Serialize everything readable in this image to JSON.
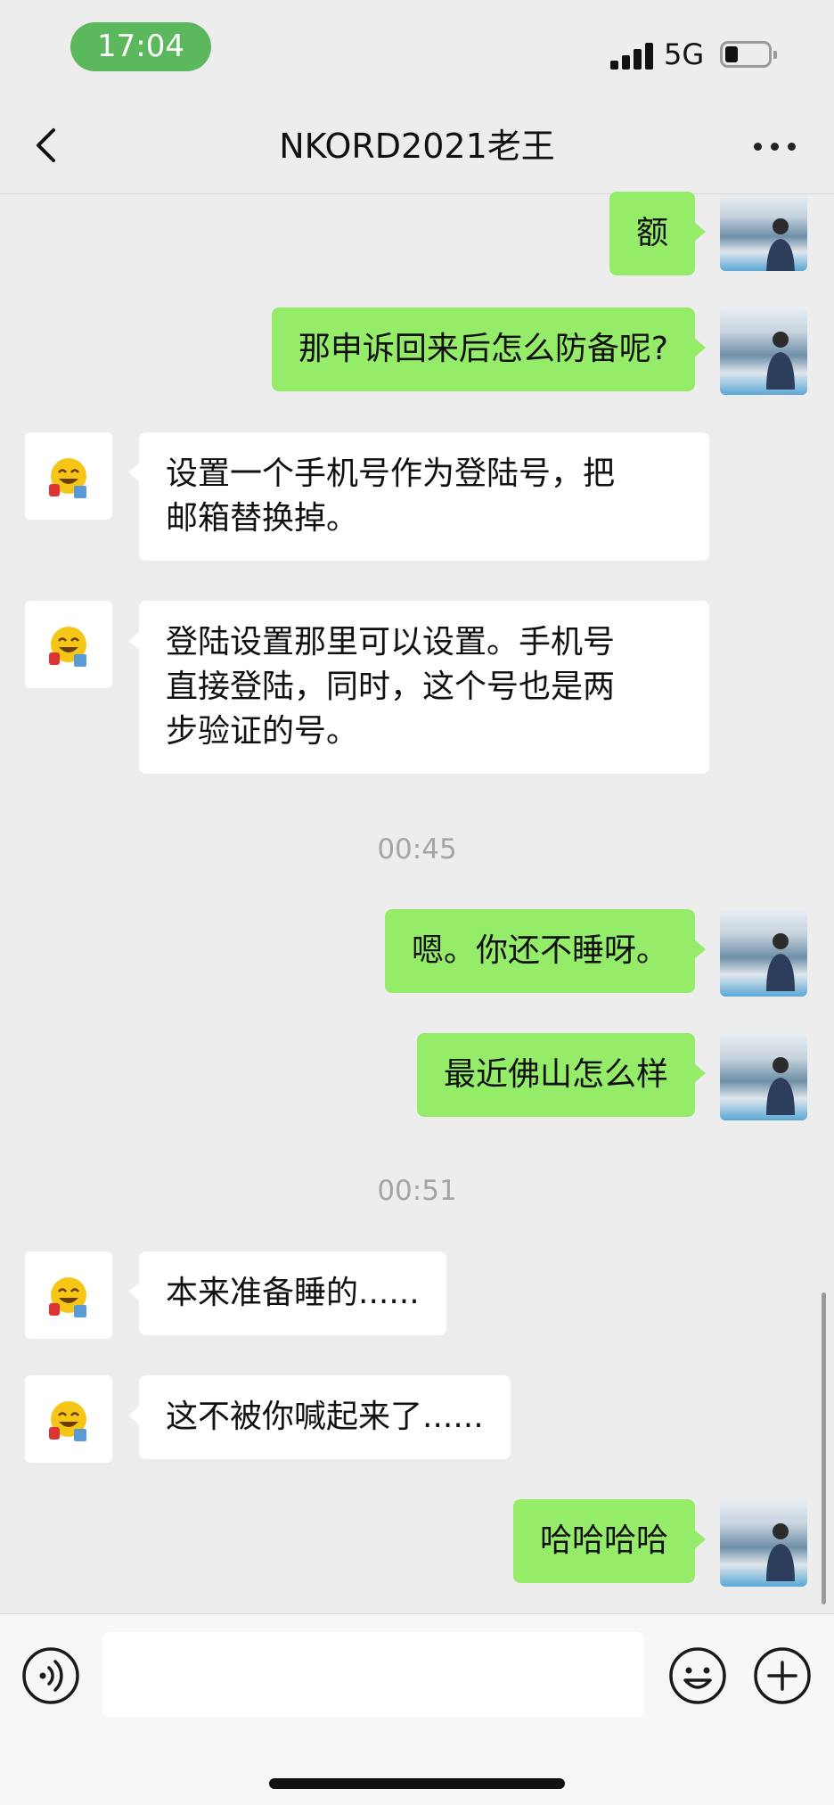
{
  "status_bar": {
    "time": "17:04",
    "network": "5G"
  },
  "header": {
    "title": "NKORD2021老王"
  },
  "messages": [
    {
      "sender": "self",
      "text": "额"
    },
    {
      "sender": "self",
      "text": "那申诉回来后怎么防备呢?"
    },
    {
      "sender": "other",
      "text": "设置一个手机号作为登陆号，把\n邮箱替换掉。"
    },
    {
      "sender": "other",
      "text": "登陆设置那里可以设置。手机号\n直接登陆，同时，这个号也是两\n步验证的号。"
    },
    {
      "type": "time",
      "text": "00:45"
    },
    {
      "sender": "self",
      "text": "嗯。你还不睡呀。"
    },
    {
      "sender": "self",
      "text": "最近佛山怎么样"
    },
    {
      "type": "time",
      "text": "00:51"
    },
    {
      "sender": "other",
      "text": "本来准备睡的......"
    },
    {
      "sender": "other",
      "text": "这不被你喊起来了......"
    },
    {
      "sender": "self",
      "text": "哈哈哈哈"
    }
  ],
  "input_bar": {
    "value": "",
    "icons": [
      "voice-icon",
      "emoji-icon",
      "plus-icon"
    ]
  },
  "colors": {
    "self_bubble": "#95ec69",
    "other_bubble": "#ffffff",
    "background": "#ededed",
    "time_pill": "#5cb85c"
  }
}
